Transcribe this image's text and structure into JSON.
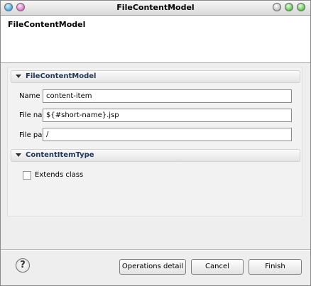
{
  "window": {
    "title": "FileContentModel"
  },
  "banner": {
    "title": "FileContentModel"
  },
  "sections": {
    "file_content_model": {
      "label": "FileContentModel",
      "fields": {
        "name": {
          "label": "Name",
          "value": "content-item"
        },
        "file_name": {
          "label": "File name",
          "value": "${#short-name}.jsp"
        },
        "file_path": {
          "label": "File path",
          "value": "/"
        }
      }
    },
    "content_item_type": {
      "label": "ContentItemType",
      "extends_class": {
        "label": "Extends class",
        "checked": false
      }
    }
  },
  "buttons": {
    "help": "?",
    "operations_detail": "Operations detail",
    "cancel": "Cancel",
    "finish": "Finish"
  },
  "colors": {
    "close_button": "#45a8e0",
    "minimize_button": "#e072c6",
    "titlebar_right_buttons": "#5cc24a",
    "section_title": "#23375a"
  },
  "icons": {
    "titlebar_left": "close-icon",
    "titlebar_left_2": "menu-icon",
    "titlebar_right": [
      "shade-icon",
      "minimize-icon",
      "maximize-icon"
    ],
    "section_toggle": "triangle-down-icon",
    "help": "help-icon"
  }
}
